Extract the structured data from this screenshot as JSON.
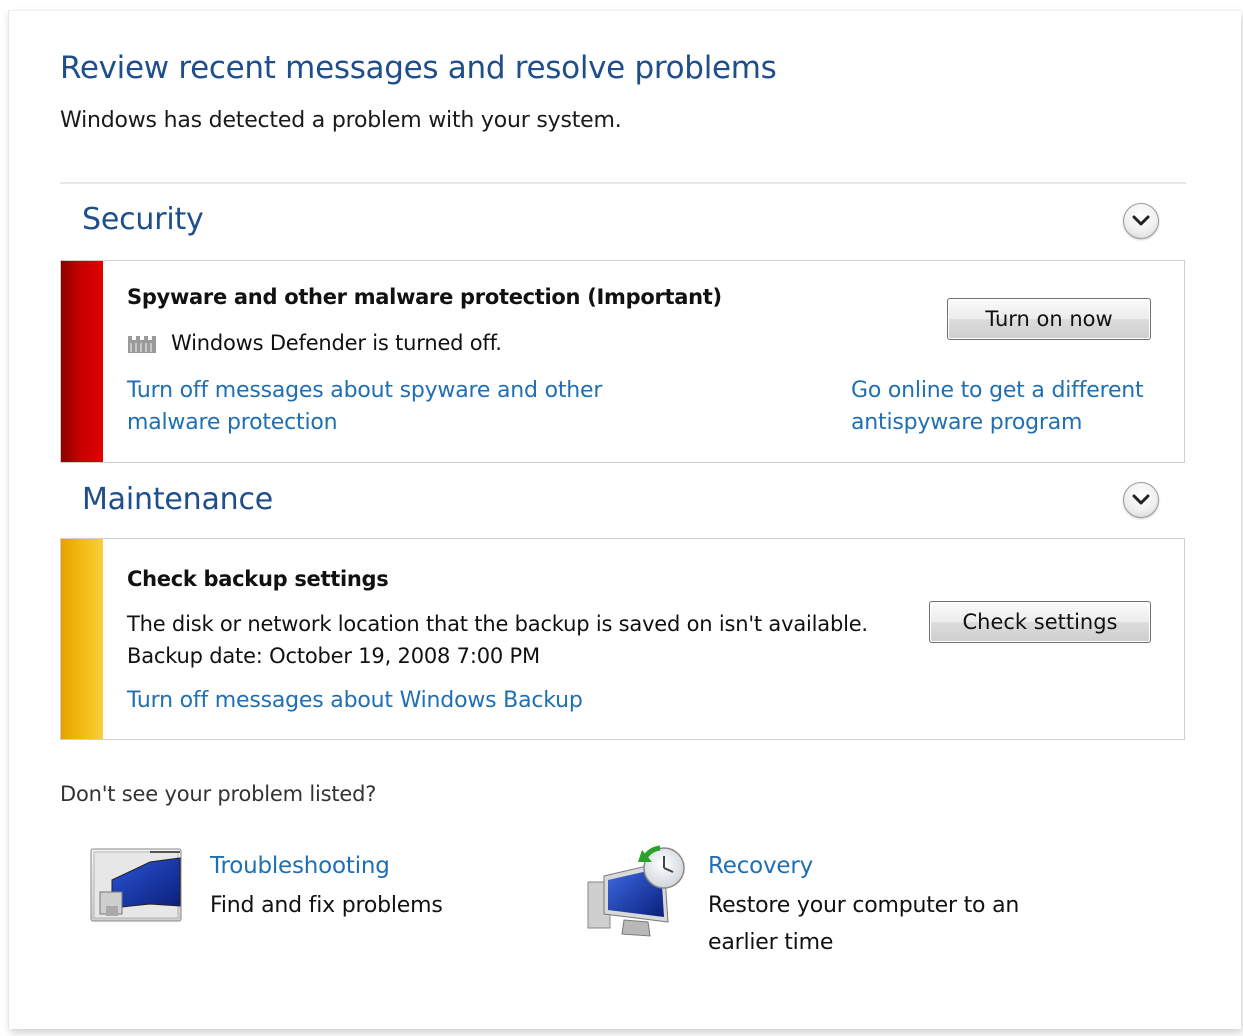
{
  "header": {
    "title": "Review recent messages and resolve problems",
    "subtitle": "Windows has detected a problem with your system."
  },
  "sections": {
    "security": {
      "title": "Security",
      "item_title": "Spyware and other malware protection  (Important)",
      "item_status": "Windows Defender is turned off.",
      "button_label": "Turn on now",
      "turn_off_link": "Turn off messages about spyware and other malware protection",
      "online_link": "Go online to get a different antispyware program",
      "stripe_color": "#c80000"
    },
    "maintenance": {
      "title": "Maintenance",
      "item_title": "Check backup settings",
      "item_text": "The disk or network location that the backup is saved on isn't available.",
      "backup_date": "Backup date: October 19, 2008 7:00 PM",
      "button_label": "Check settings",
      "turn_off_link": "Turn off messages about Windows Backup",
      "stripe_color": "#f4bb14"
    }
  },
  "footer": {
    "prompt": "Don't see your problem listed?",
    "troubleshooting": {
      "link": "Troubleshooting",
      "description": "Find and fix problems",
      "icon": "troubleshooting-monitor-icon"
    },
    "recovery": {
      "link": "Recovery",
      "description": "Restore your computer to an earlier time",
      "icon": "recovery-monitor-icon"
    }
  },
  "icons": {
    "expand": "chevron-down-icon",
    "defender": "fortress-icon"
  },
  "colors": {
    "heading_blue": "#1f4e8c",
    "link_blue": "#1f6fb5"
  }
}
